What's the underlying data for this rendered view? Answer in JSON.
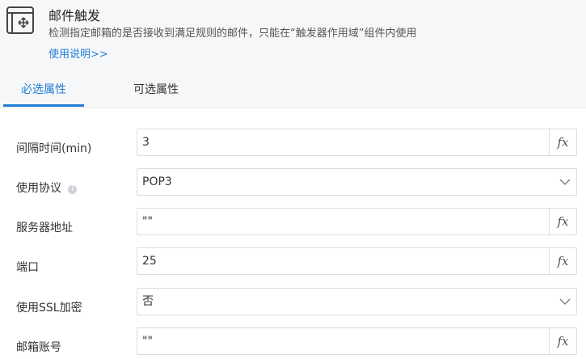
{
  "header": {
    "title": "邮件触发",
    "description": "检测指定邮箱的是否接收到满足规则的邮件，只能在“触发器作用域”组件内使用",
    "help_link": "使用说明>>",
    "icon": "email-trigger-icon"
  },
  "tabs": [
    {
      "label": "必选属性",
      "active": true
    },
    {
      "label": "可选属性",
      "active": false
    }
  ],
  "fields": [
    {
      "label": "间隔时间(min)",
      "value": "3",
      "control": "expression"
    },
    {
      "label": "使用协议",
      "value": "POP3",
      "control": "select",
      "info": "i"
    },
    {
      "label": "服务器地址",
      "value": "\"\"",
      "control": "expression"
    },
    {
      "label": "端口",
      "value": "25",
      "control": "expression"
    },
    {
      "label": "使用SSL加密",
      "value": "否",
      "control": "select"
    },
    {
      "label": "邮箱账号",
      "value": "\"\"",
      "control": "expression"
    }
  ],
  "fx_label": "fx",
  "colors": {
    "accent": "#1f7ed6",
    "header_bg": "#f6f7f9",
    "border": "#d9dde2"
  }
}
